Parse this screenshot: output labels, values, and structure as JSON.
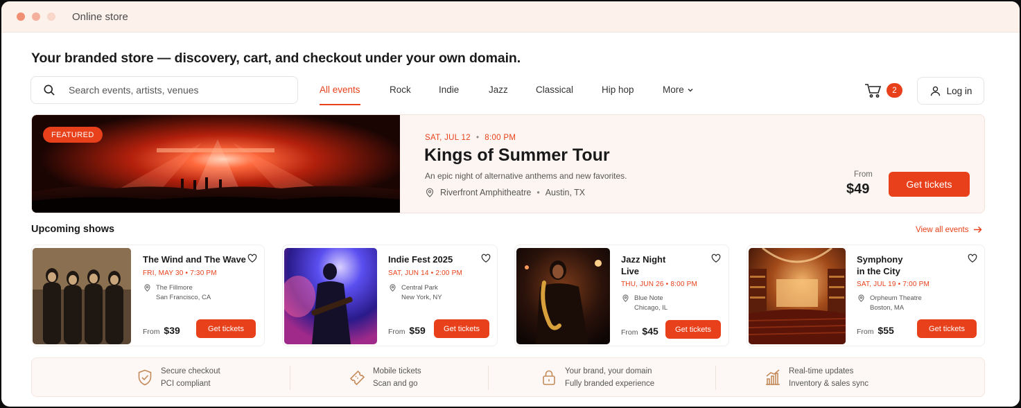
{
  "window": {
    "title": "Online store"
  },
  "headline": "Your branded store — discovery, cart, and checkout under your own domain.",
  "search": {
    "placeholder": "Search events, artists, venues"
  },
  "nav": {
    "items": [
      {
        "label": "All events",
        "active": true
      },
      {
        "label": "Rock"
      },
      {
        "label": "Indie"
      },
      {
        "label": "Jazz"
      },
      {
        "label": "Classical"
      },
      {
        "label": "Hip hop"
      },
      {
        "label": "More"
      }
    ]
  },
  "cart": {
    "count": "2",
    "icon": "cart-icon"
  },
  "login": {
    "label": "Log in",
    "icon": "user-icon"
  },
  "featured": {
    "badge": "FEATURED",
    "date": "SAT, JUL 12",
    "time": "8:00 PM",
    "title": "Kings of Summer Tour",
    "description": "An epic night of alternative anthems and new favorites.",
    "venue": "Riverfront Amphitheatre",
    "city": "Austin, TX",
    "from_label": "From",
    "price": "$49",
    "cta": "Get tickets"
  },
  "upcoming": {
    "title": "Upcoming shows",
    "view_all": "View all events",
    "shows": [
      {
        "title_line1": "The Wind and The Wave",
        "title_line2": "",
        "date": "FRI, MAY 30",
        "time": "7:30 PM",
        "venue": "The Fillmore",
        "city": "San Francisco, CA",
        "from_label": "From",
        "price": "$39",
        "cta": "Get tickets"
      },
      {
        "title_line1": "Indie Fest 2025",
        "title_line2": "",
        "date": "SAT, JUN 14",
        "time": "2:00 PM",
        "venue": "Central Park",
        "city": "New York, NY",
        "from_label": "From",
        "price": "$59",
        "cta": "Get tickets"
      },
      {
        "title_line1": "Jazz Night",
        "title_line2": "Live",
        "date": "THU, JUN 26",
        "time": "8:00 PM",
        "venue": "Blue Note",
        "city": "Chicago, IL",
        "from_label": "From",
        "price": "$45",
        "cta": "Get tickets"
      },
      {
        "title_line1": "Symphony",
        "title_line2": "in the City",
        "date": "SAT, JUL 19",
        "time": "7:00 PM",
        "venue": "Orpheum Theatre",
        "city": "Boston, MA",
        "from_label": "From",
        "price": "$55",
        "cta": "Get tickets"
      }
    ]
  },
  "features": [
    {
      "icon": "shield-check-icon",
      "title": "Secure checkout",
      "subtitle": "PCI compliant"
    },
    {
      "icon": "ticket-icon",
      "title": "Mobile tickets",
      "subtitle": "Scan and go"
    },
    {
      "icon": "lock-icon",
      "title": "Your brand, your domain",
      "subtitle": "Fully branded experience"
    },
    {
      "icon": "bar-chart-icon",
      "title": "Real-time updates",
      "subtitle": "Inventory & sales sync"
    }
  ],
  "colors": {
    "accent": "#e8401a",
    "hero_bg": "#fdf5f1",
    "titlebar_bg": "#fdf1ec"
  }
}
